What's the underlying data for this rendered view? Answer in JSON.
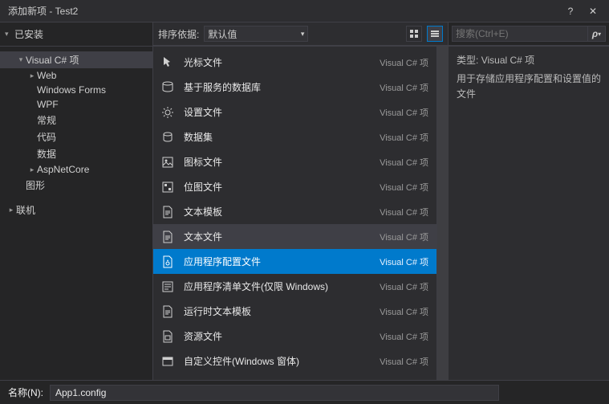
{
  "window": {
    "title": "添加新项 - Test2",
    "help": "?",
    "close": "✕"
  },
  "sidebar": {
    "installed": "已安装",
    "items": [
      {
        "label": "Visual C# 项",
        "depth": 1,
        "expanded": true,
        "selected": true
      },
      {
        "label": "Web",
        "depth": 2,
        "expanded": false,
        "arrow": true
      },
      {
        "label": "Windows Forms",
        "depth": 2
      },
      {
        "label": "WPF",
        "depth": 2
      },
      {
        "label": "常规",
        "depth": 2
      },
      {
        "label": "代码",
        "depth": 2
      },
      {
        "label": "数据",
        "depth": 2
      },
      {
        "label": "AspNetCore",
        "depth": 2,
        "arrow": true
      },
      {
        "label": "图形",
        "depth": 1
      }
    ],
    "online": "联机"
  },
  "center": {
    "sort_label": "排序依据:",
    "sort_value": "默认值",
    "lang": "Visual C# 项",
    "items": [
      {
        "label": "光标文件",
        "icon": "cursor"
      },
      {
        "label": "基于服务的数据库",
        "icon": "db"
      },
      {
        "label": "设置文件",
        "icon": "gear"
      },
      {
        "label": "数据集",
        "icon": "dataset"
      },
      {
        "label": "图标文件",
        "icon": "image"
      },
      {
        "label": "位图文件",
        "icon": "bitmap"
      },
      {
        "label": "文本模板",
        "icon": "doc"
      },
      {
        "label": "文本文件",
        "icon": "doc",
        "hover": true
      },
      {
        "label": "应用程序配置文件",
        "icon": "config",
        "selected": true
      },
      {
        "label": "应用程序清单文件(仅限 Windows)",
        "icon": "manifest"
      },
      {
        "label": "运行时文本模板",
        "icon": "doc"
      },
      {
        "label": "资源文件",
        "icon": "resource"
      },
      {
        "label": "自定义控件(Windows 窗体)",
        "icon": "control"
      }
    ]
  },
  "detail": {
    "search_placeholder": "搜索(Ctrl+E)",
    "type_label": "类型:",
    "type_value": "Visual C# 项",
    "description": "用于存储应用程序配置和设置值的文件"
  },
  "bottom": {
    "name_label": "名称(N):",
    "name_value": "App1.config"
  }
}
